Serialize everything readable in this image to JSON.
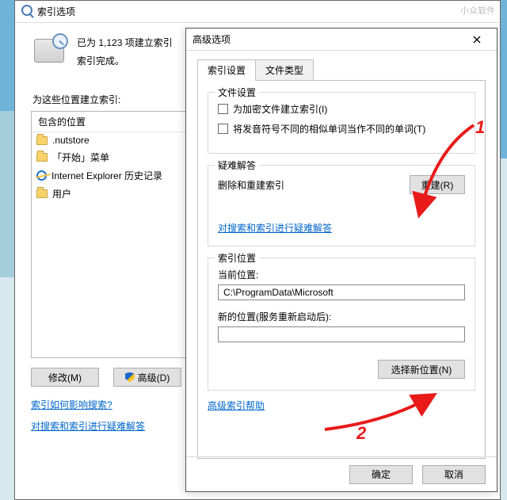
{
  "watermark": "小众软件",
  "index_window": {
    "title": "索引选项",
    "status_count": "已为 1,123 项建立索引",
    "status_done": "索引完成。",
    "locations_label": "为这些位置建立索引:",
    "column_header": "包含的位置",
    "items": [
      {
        "label": ".nutstore"
      },
      {
        "label": "「开始」菜单"
      },
      {
        "label": "Internet Explorer 历史记录"
      },
      {
        "label": "用户"
      }
    ],
    "modify_btn": "修改(M)",
    "advanced_btn": "高级(D)",
    "link_how": "索引如何影响搜索?",
    "link_ts": "对搜索和索引进行疑难解答"
  },
  "adv_window": {
    "title": "高级选项",
    "tabs": {
      "settings": "索引设置",
      "filetypes": "文件类型"
    },
    "file_settings": {
      "legend": "文件设置",
      "encrypt": "为加密文件建立索引(I)",
      "diacritics": "将发音符号不同的相似单词当作不同的单词(T)"
    },
    "troubleshoot": {
      "legend": "疑难解答",
      "rebuild_desc": "删除和重建索引",
      "rebuild_btn": "重建(R)",
      "ts_link": "对搜索和索引进行疑难解答"
    },
    "location": {
      "legend": "索引位置",
      "current_label": "当前位置:",
      "current_value": "C:\\ProgramData\\Microsoft",
      "new_label": "新的位置(服务重新启动后):",
      "new_value": "",
      "choose_btn": "选择新位置(N)"
    },
    "help_link": "高级索引帮助",
    "ok_btn": "确定",
    "cancel_btn": "取消"
  },
  "annotations": {
    "one": "1",
    "two": "2"
  }
}
